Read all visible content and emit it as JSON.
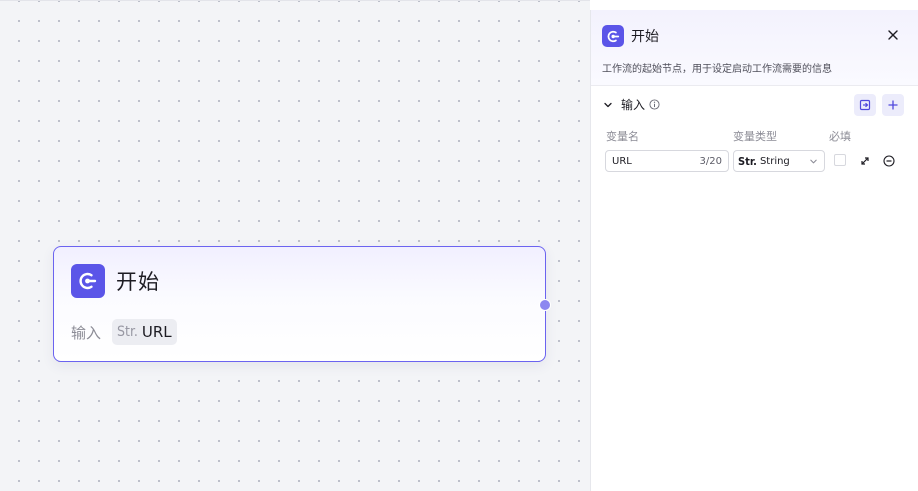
{
  "node": {
    "title": "开始",
    "input_label": "输入",
    "var_type_short": "Str.",
    "var_name": "URL",
    "icon": "start-node-icon",
    "accent_color": "#5b55e8"
  },
  "panel": {
    "title": "开始",
    "description": "工作流的起始节点，用于设定启动工作流需要的信息",
    "section_title": "输入",
    "columns": {
      "name": "变量名",
      "type": "变量类型",
      "required": "必填"
    },
    "variable": {
      "name": "URL",
      "counter": "3/20",
      "type_short": "Str.",
      "type_name": "String",
      "required": false
    }
  }
}
